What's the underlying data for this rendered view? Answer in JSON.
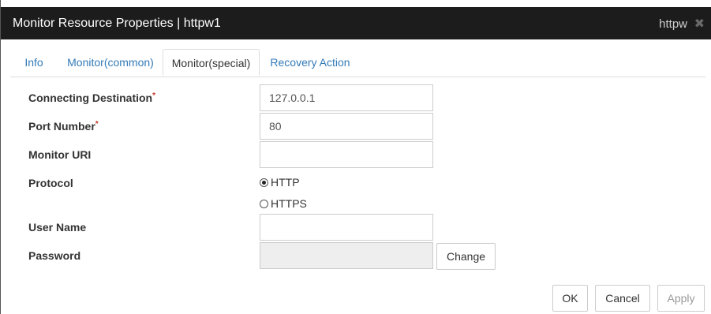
{
  "window": {
    "title": "Monitor Resource Properties | httpw1",
    "resource_type": "httpw",
    "close_icon": "close-icon"
  },
  "tabs": [
    {
      "label": "Info",
      "active": false
    },
    {
      "label": "Monitor(common)",
      "active": false
    },
    {
      "label": "Monitor(special)",
      "active": true
    },
    {
      "label": "Recovery Action",
      "active": false
    }
  ],
  "form": {
    "required_mark": "*",
    "connecting_destination": {
      "label": "Connecting Destination",
      "value": "127.0.0.1"
    },
    "port_number": {
      "label": "Port Number",
      "value": "80"
    },
    "monitor_uri": {
      "label": "Monitor URI",
      "value": ""
    },
    "protocol": {
      "label": "Protocol",
      "options": [
        {
          "label": "HTTP",
          "selected": true
        },
        {
          "label": "HTTPS",
          "selected": false
        }
      ]
    },
    "user_name": {
      "label": "User Name",
      "value": ""
    },
    "password": {
      "label": "Password",
      "value": "",
      "change_label": "Change"
    }
  },
  "footer": {
    "ok_label": "OK",
    "cancel_label": "Cancel",
    "apply_label": "Apply"
  }
}
